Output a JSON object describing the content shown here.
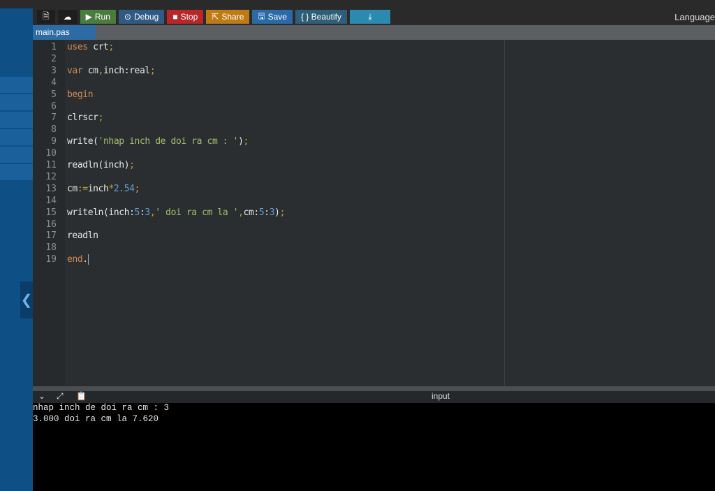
{
  "toolbar": {
    "buttons": [
      {
        "id": "new-file",
        "label": "",
        "icon": "file-icon",
        "color": "#1e1e1e"
      },
      {
        "id": "upload",
        "label": "",
        "icon": "cloud-upload-icon",
        "color": "#1e1e1e"
      },
      {
        "id": "run",
        "label": "Run",
        "icon": "play-icon",
        "color": "#4a7c3f"
      },
      {
        "id": "debug",
        "label": "Debug",
        "icon": "debug-icon",
        "color": "#2e5a83"
      },
      {
        "id": "stop",
        "label": "Stop",
        "icon": "stop-icon",
        "color": "#b8262a"
      },
      {
        "id": "share",
        "label": "Share",
        "icon": "share-icon",
        "color": "#c07a14"
      },
      {
        "id": "save",
        "label": "Save",
        "icon": "save-icon",
        "color": "#2a6aa8"
      },
      {
        "id": "beautify",
        "label": "{ } Beautify",
        "icon": "",
        "color": "#2f5f78"
      },
      {
        "id": "download",
        "label": "",
        "icon": "download-icon",
        "color": "#2a8ab0"
      }
    ],
    "language_label": "Language"
  },
  "tab": {
    "label": "main.pas"
  },
  "code": [
    [
      [
        "uses",
        "kw"
      ],
      [
        " crt",
        "id"
      ],
      [
        ";",
        "pu"
      ]
    ],
    [],
    [
      [
        "var",
        "kw"
      ],
      [
        " cm",
        "id"
      ],
      [
        ",",
        "pu"
      ],
      [
        "inch:real",
        "id"
      ],
      [
        ";",
        "pu"
      ]
    ],
    [],
    [
      [
        "begin",
        "kw"
      ]
    ],
    [],
    [
      [
        "clrscr",
        "id"
      ],
      [
        ";",
        "pu"
      ]
    ],
    [],
    [
      [
        "write(",
        "id"
      ],
      [
        "'nhap inch de doi ra cm : '",
        "st"
      ],
      [
        ")",
        "id"
      ],
      [
        ";",
        "pu"
      ]
    ],
    [],
    [
      [
        "readln(inch)",
        "id"
      ],
      [
        ";",
        "pu"
      ]
    ],
    [],
    [
      [
        "cm",
        "id"
      ],
      [
        ":=",
        "pu"
      ],
      [
        "inch",
        "id"
      ],
      [
        "*",
        "pu"
      ],
      [
        "2.54",
        "nu"
      ],
      [
        ";",
        "pu"
      ]
    ],
    [],
    [
      [
        "writeln(inch:",
        "id"
      ],
      [
        "5",
        "nu"
      ],
      [
        ":",
        "id"
      ],
      [
        "3",
        "nu"
      ],
      [
        ",",
        "pu"
      ],
      [
        "' doi ra cm la '",
        "st"
      ],
      [
        ",",
        "pu"
      ],
      [
        "cm:",
        "id"
      ],
      [
        "5",
        "nu"
      ],
      [
        ":",
        "id"
      ],
      [
        "3",
        "nu"
      ],
      [
        ")",
        "id"
      ],
      [
        ";",
        "pu"
      ]
    ],
    [],
    [
      [
        "readln",
        "id"
      ]
    ],
    [],
    [
      [
        "end",
        "kw"
      ],
      [
        ".",
        "id"
      ]
    ]
  ],
  "output_panel": {
    "label": "input",
    "icons": [
      "chevron-down-icon",
      "expand-icon",
      "clipboard-icon"
    ],
    "lines": [
      "nhap inch de doi ra cm : 3",
      "3.000 doi ra cm la 7.620"
    ]
  }
}
